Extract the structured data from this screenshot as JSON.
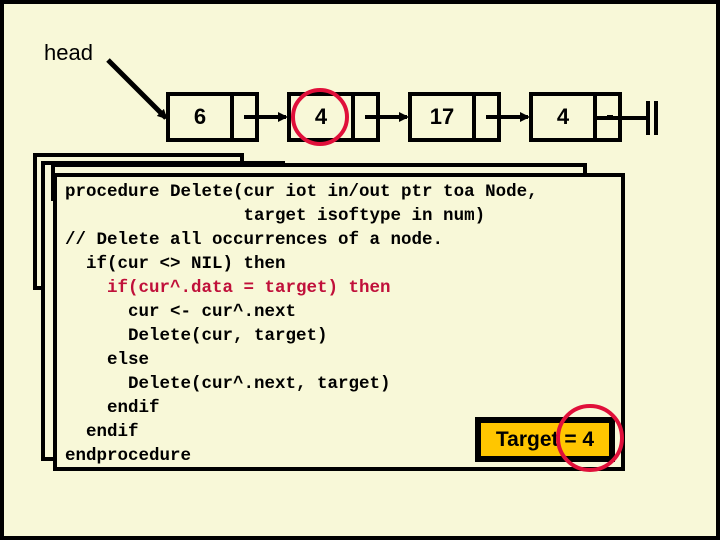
{
  "diagram": {
    "head_label": "head",
    "nodes": [
      {
        "value": "6",
        "highlighted": false
      },
      {
        "value": "4",
        "highlighted": true
      },
      {
        "value": "17",
        "highlighted": false
      },
      {
        "value": "4",
        "highlighted": false
      }
    ],
    "terminator": "NIL"
  },
  "code": {
    "lines": [
      {
        "text": "procedure Delete(cur iot in/out ptr toa Node,",
        "highlight": false
      },
      {
        "text": "                 target isoftype in num)",
        "highlight": false
      },
      {
        "text": "// Delete all occurrences of a node.",
        "highlight": false
      },
      {
        "text": "  if(cur <> NIL) then",
        "highlight": false
      },
      {
        "text": "    if(cur^.data = target) then",
        "highlight": true
      },
      {
        "text": "      cur <- cur^.next",
        "highlight": false
      },
      {
        "text": "      Delete(cur, target)",
        "highlight": false
      },
      {
        "text": "    else",
        "highlight": false
      },
      {
        "text": "      Delete(cur^.next, target)",
        "highlight": false
      },
      {
        "text": "    endif",
        "highlight": false
      },
      {
        "text": "  endif",
        "highlight": false
      },
      {
        "text": "endprocedure",
        "highlight": false
      }
    ]
  },
  "target": {
    "label": "Target = 4",
    "value": 4
  },
  "colors": {
    "background": "#f8f8d8",
    "highlight_text": "#c0103a",
    "circle": "#e0103a",
    "badge": "#ffc600"
  }
}
